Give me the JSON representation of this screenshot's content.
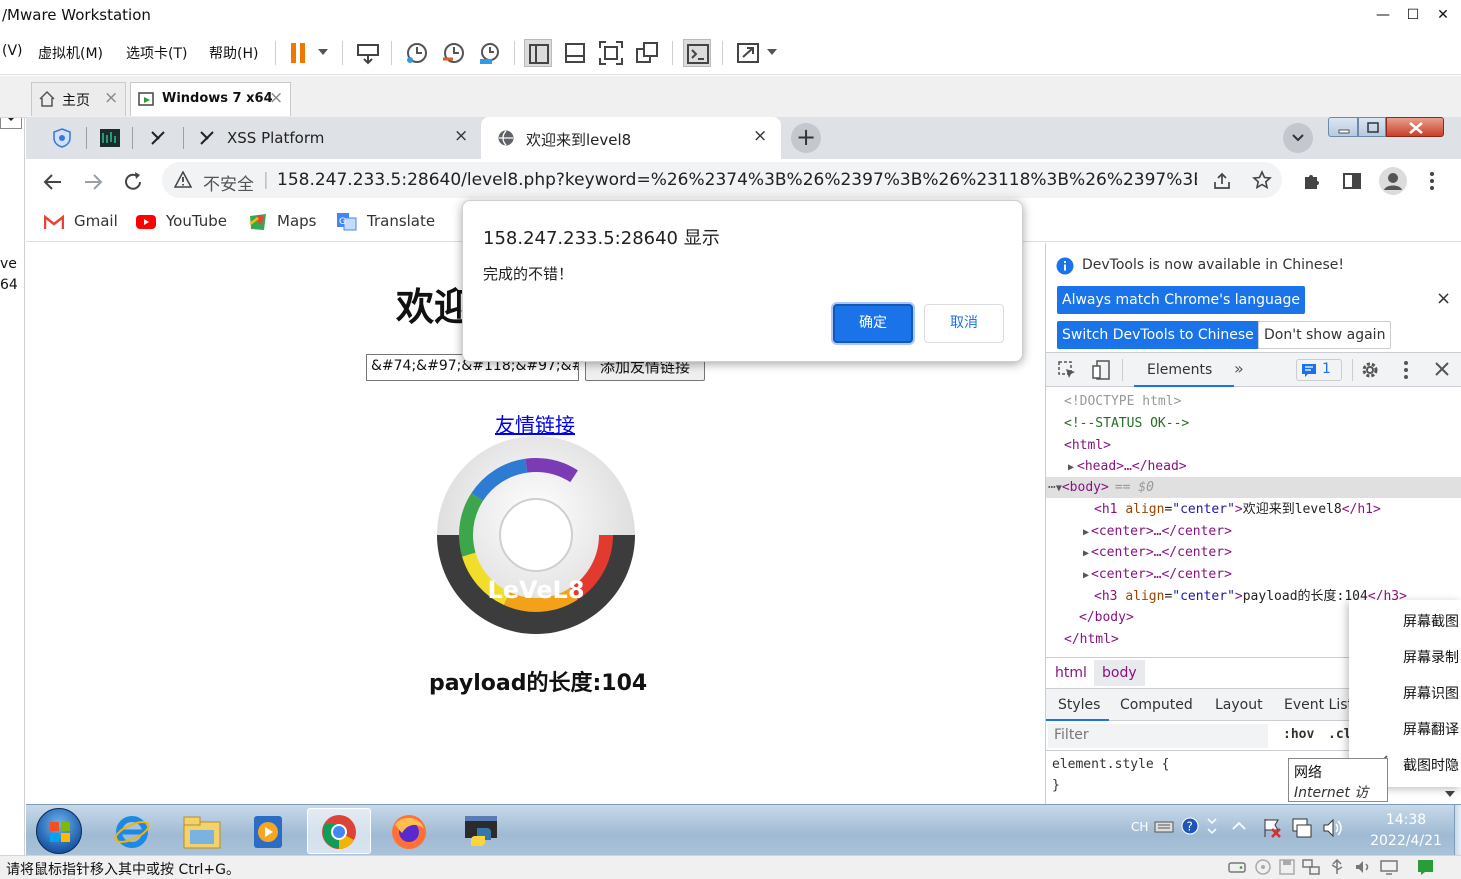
{
  "vmware": {
    "title": "/Mware Workstation",
    "menu": [
      "(V)",
      "虚拟机(M)",
      "选项卡(T)",
      "帮助(H)"
    ],
    "tabs": [
      {
        "label": "主页",
        "close": "×"
      },
      {
        "label": "Windows 7 x64",
        "close": "×"
      }
    ],
    "left_panel": {
      "top_symbol": "×",
      "text1": "ve",
      "text2": "64"
    },
    "status_text": "请将鼠标指针移入其中或按 Ctrl+G。"
  },
  "chrome": {
    "tabs": [
      {
        "title": "XSS Platform",
        "close": "×"
      },
      {
        "title": "欢迎来到level8",
        "close": "×"
      }
    ],
    "new_tab": "+",
    "security_label": "不安全",
    "url": "158.247.233.5:28640/level8.php?keyword=%26%2374%3B%26%2397%3B%26%23118%3B%26%2397%3B%...",
    "bookmarks": [
      "Gmail",
      "YouTube",
      "Maps",
      "Translate"
    ]
  },
  "page": {
    "h1": "欢迎",
    "input_value": "&#74;&#97;&#118;&#97;&#",
    "submit_label": "添加友情链接",
    "link_text": "友情链接",
    "cd_label": "LeVeL8",
    "payload_length": "payload的长度:104"
  },
  "alert": {
    "origin": "158.247.233.5:28640 显示",
    "message": "完成的不错！",
    "ok": "确定",
    "cancel": "取消"
  },
  "devtools": {
    "banner": "DevTools is now available in Chinese!",
    "btn_always": "Always match Chrome's language",
    "btn_switch": "Switch DevTools to Chinese",
    "btn_dont": "Don't show again",
    "close": "×",
    "tab_elements": "Elements",
    "more": "»",
    "issues_count": "1",
    "dom": {
      "doctype": "<!DOCTYPE html>",
      "comment": "<!--STATUS OK-->",
      "html_open": "<html>",
      "head": "<head>…</head>",
      "body_open": "<body>",
      "body_marker": "== $0",
      "h1_tag_open": "<h1 ",
      "h1_attr": "align",
      "h1_val": "\"center\"",
      "h1_text": "欢迎来到level8",
      "h1_close": "</h1>",
      "center": "<center>…</center>",
      "h3_tag_open": "<h3 ",
      "h3_attr": "align",
      "h3_val": "\"center\"",
      "h3_text": "payload的长度:104",
      "h3_close": "</h3>",
      "body_close": "</body>",
      "html_close": "</html>"
    },
    "crumbs": [
      "html",
      "body"
    ],
    "subtabs": [
      "Styles",
      "Computed",
      "Layout",
      "Event Listeners"
    ],
    "filter_placeholder": "Filter",
    "hov": ":hov",
    "cls": ".cls",
    "element_style": "element.style {",
    "close_brace": "}"
  },
  "context_menu": [
    "屏幕截图",
    "屏幕录制",
    "屏幕识图",
    "屏幕翻译",
    "截图时隐"
  ],
  "tooltip": {
    "line1": "网络",
    "line2": "Internet 访问"
  },
  "taskbar": {
    "lang": "CH",
    "time": "14:38",
    "date": "2022/4/21"
  }
}
